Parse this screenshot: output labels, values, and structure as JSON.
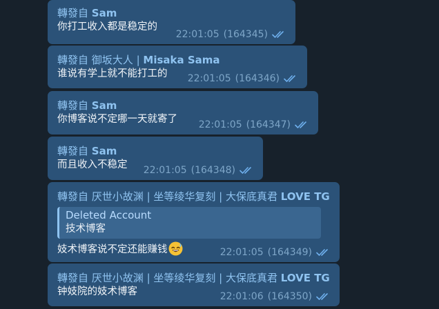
{
  "chat": {
    "messages": [
      {
        "forward_prefix": "轉發自",
        "forward_name": "Sam",
        "text": "你打工收入都是稳定的",
        "time": "22:01:05",
        "msg_id": "(164345)"
      },
      {
        "forward_prefix": "轉發自",
        "forward_name": "御坂大人 | Misaka Sama",
        "forward_name_plain": "御坂大人 | ",
        "forward_name_bold": "Misaka Sama",
        "text": "谁说有学上就不能打工的",
        "time": "22:01:05",
        "msg_id": "(164346)"
      },
      {
        "forward_prefix": "轉發自",
        "forward_name": "Sam",
        "text": "你博客说不定哪一天就寄了",
        "time": "22:01:05",
        "msg_id": "(164347)"
      },
      {
        "forward_prefix": "轉發自",
        "forward_name": "Sam",
        "text": "而且收入不稳定",
        "time": "22:01:05",
        "msg_id": "(164348)"
      },
      {
        "forward_prefix": "轉發自",
        "forward_name_plain": "厌世小故渊 | 坐等绫华复刻 | 大保底真君 ",
        "forward_name_bold": "LOVE TG",
        "reply_name": "Deleted Account",
        "reply_text": "技术博客",
        "text": "妓术博客说不定还能赚钱",
        "emoji": "sweat-smile-emoji",
        "time": "22:01:05",
        "msg_id": "(164349)"
      },
      {
        "forward_prefix": "轉發自",
        "forward_name_plain": "厌世小故渊 | 坐等绫华复刻 | 大保底真君 ",
        "forward_name_bold": "LOVE TG",
        "text": "钟妓院的妓术博客",
        "time": "22:01:06",
        "msg_id": "(164350)"
      }
    ]
  },
  "colors": {
    "background": "#17212b",
    "bubble": "#2b5278",
    "forward_accent": "#8fc3f0",
    "meta": "#7ea6c8",
    "read_check": "#6fb0ee"
  },
  "icons": {
    "read_status": "double-check-icon"
  }
}
